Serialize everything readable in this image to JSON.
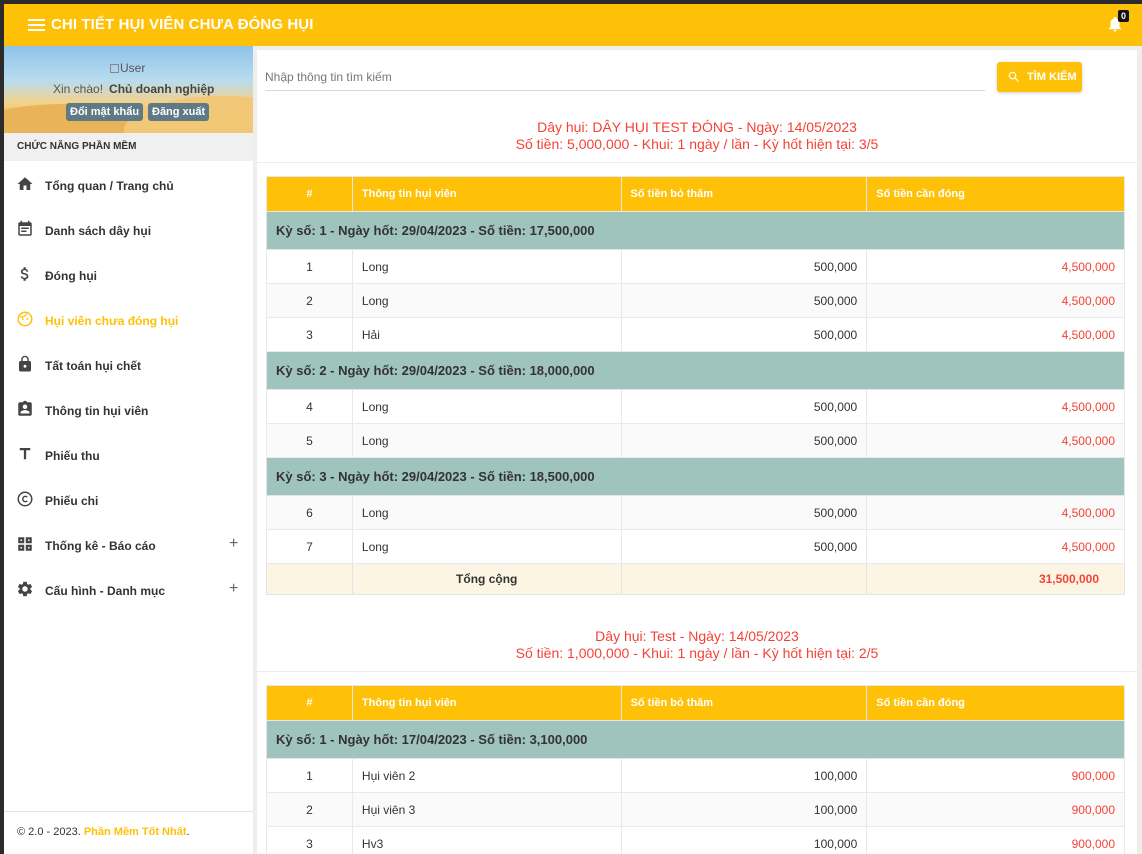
{
  "header": {
    "title": "CHI TIẾT HỤI VIÊN CHƯA ĐÓNG HỤI",
    "notification_count": "0"
  },
  "sidebar": {
    "user_img_alt": "User",
    "greeting": "Xin chào!",
    "role": "Chủ doanh nghiệp",
    "change_password": "Đổi mật khẩu",
    "logout": "Đăng xuất",
    "section_title": "CHỨC NĂNG PHẦN MỀM",
    "items": [
      {
        "label": "Tổng quan / Trang chủ",
        "icon": "home-icon"
      },
      {
        "label": "Danh sách dây hụi",
        "icon": "calendar-list-icon"
      },
      {
        "label": "Đóng hụi",
        "icon": "dollar-icon"
      },
      {
        "label": "Hụi viên chưa đóng hụi",
        "icon": "face-icon"
      },
      {
        "label": "Tất toán hụi chết",
        "icon": "lock-icon"
      },
      {
        "label": "Thông tin hụi viên",
        "icon": "contact-icon"
      },
      {
        "label": "Phiếu thu",
        "icon": "text-icon"
      },
      {
        "label": "Phiếu chi",
        "icon": "copyright-icon"
      },
      {
        "label": "Thống kê - Báo cáo",
        "icon": "widgets-icon"
      },
      {
        "label": "Cấu hình - Danh mục",
        "icon": "gear-icon"
      }
    ],
    "footer_prefix": "© 2.0 - 2023.",
    "footer_brand": "Phần Mềm Tốt Nhất",
    "footer_suffix": "."
  },
  "search": {
    "placeholder": "Nhập thông tin tìm kiếm",
    "button": "TÌM KIẾM"
  },
  "table_headers": {
    "idx": "#",
    "member": "Thông tin hụi viên",
    "paid": "Số tiền bỏ thăm",
    "due": "Số tiền cần đóng"
  },
  "blocks": [
    {
      "title1": "Dây hụi: DÂY HỤI TEST ĐÓNG - Ngày: 14/05/2023",
      "title2": "Số tiền: 5,000,000 - Khui: 1 ngày / lần - Kỳ hốt hiện tại: 3/5",
      "groups": [
        {
          "label": "Kỳ số: 1 - Ngày hốt: 29/04/2023 - Số tiền: 17,500,000",
          "rows": [
            {
              "idx": "1",
              "name": "Long",
              "paid": "500,000",
              "due": "4,500,000"
            },
            {
              "idx": "2",
              "name": "Long",
              "paid": "500,000",
              "due": "4,500,000"
            },
            {
              "idx": "3",
              "name": "Hải",
              "paid": "500,000",
              "due": "4,500,000"
            }
          ]
        },
        {
          "label": "Kỳ số: 2 - Ngày hốt: 29/04/2023 - Số tiền: 18,000,000",
          "rows": [
            {
              "idx": "4",
              "name": "Long",
              "paid": "500,000",
              "due": "4,500,000"
            },
            {
              "idx": "5",
              "name": "Long",
              "paid": "500,000",
              "due": "4,500,000"
            }
          ]
        },
        {
          "label": "Kỳ số: 3 - Ngày hốt: 29/04/2023 - Số tiền: 18,500,000",
          "rows": [
            {
              "idx": "6",
              "name": "Long",
              "paid": "500,000",
              "due": "4,500,000"
            },
            {
              "idx": "7",
              "name": "Long",
              "paid": "500,000",
              "due": "4,500,000"
            }
          ]
        }
      ],
      "total_label": "Tổng cộng",
      "total_value": "31,500,000"
    },
    {
      "title1": "Dây hụi: Test - Ngày: 14/05/2023",
      "title2": "Số tiền: 1,000,000 - Khui: 1 ngày / lần - Kỳ hốt hiện tại: 2/5",
      "groups": [
        {
          "label": "Kỳ số: 1 - Ngày hốt: 17/04/2023 - Số tiền: 3,100,000",
          "rows": [
            {
              "idx": "1",
              "name": "Hụi viên 2",
              "paid": "100,000",
              "due": "900,000"
            },
            {
              "idx": "2",
              "name": "Hụi viên 3",
              "paid": "100,000",
              "due": "900,000"
            },
            {
              "idx": "3",
              "name": "Hv3",
              "paid": "100,000",
              "due": "900,000"
            }
          ]
        }
      ]
    }
  ]
}
